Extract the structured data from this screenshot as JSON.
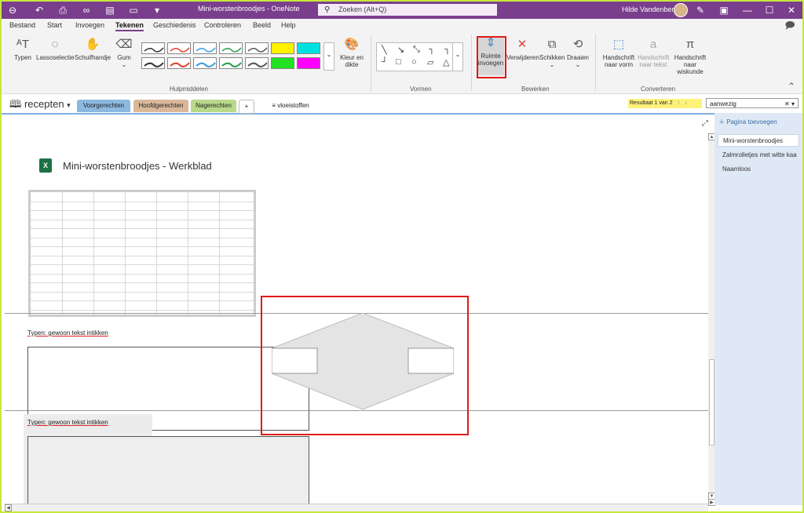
{
  "window": {
    "title": "Mini-worstenbroodjes - OneNote",
    "search_placeholder": "Zoeken (Alt+Q)",
    "user": "Hilde Vandenberk"
  },
  "menu": [
    "Bestand",
    "Start",
    "Invoegen",
    "Tekenen",
    "Geschiedenis",
    "Controleren",
    "Beeld",
    "Help"
  ],
  "menu_active": "Tekenen",
  "ribbon": {
    "tools": {
      "typen": "Typen",
      "lasso": "Lassoselectie",
      "schuif": "Schuifhandje",
      "gum": "Gum"
    },
    "kleur": "Kleur en dikte",
    "group_hulp": "Hulpmiddelen",
    "group_vormen": "Vormen",
    "bewerken": {
      "ruimte": "Ruimte invoegen",
      "verwijderen": "Verwijderen",
      "schikken": "Schikken",
      "draaien": "Draaien"
    },
    "group_bewerken": "Bewerken",
    "converteren": {
      "vorm": "Handschrift naar vorm",
      "tekst": "Handschrift naar tekst",
      "wiskunde": "Handschrift naar wiskunde"
    },
    "group_converteren": "Converteren",
    "pen_colors": [
      "#333333",
      "#e0402a",
      "#3a9be0",
      "#2a9a4a",
      "#555555",
      "#fff200",
      "#00e0e0",
      "#ff00ff"
    ]
  },
  "sections": {
    "notebook": "recepten",
    "tabs": [
      "Voorgerechten",
      "Hoofdgerechten",
      "Nagerechten",
      "+"
    ],
    "tab_colors": [
      "#8db8e0",
      "#d9b89a",
      "#b8d98a",
      "#ffffff"
    ],
    "extra": "vloeistoffen"
  },
  "find": {
    "result": "Resultaat 1 van 2",
    "query": "aanwezig"
  },
  "page": {
    "title": "Mini-worstenbroodjes - Werkblad",
    "typen1": "Typen: gewoon tekst intikken",
    "typen2": "Typen: gewoon tekst intikken"
  },
  "pages_panel": {
    "add": "Pagina toevoegen",
    "items": [
      "Mini-worstenbroodjes",
      "Zalmrolletjes met witte kaa",
      "Naamloos"
    ]
  }
}
